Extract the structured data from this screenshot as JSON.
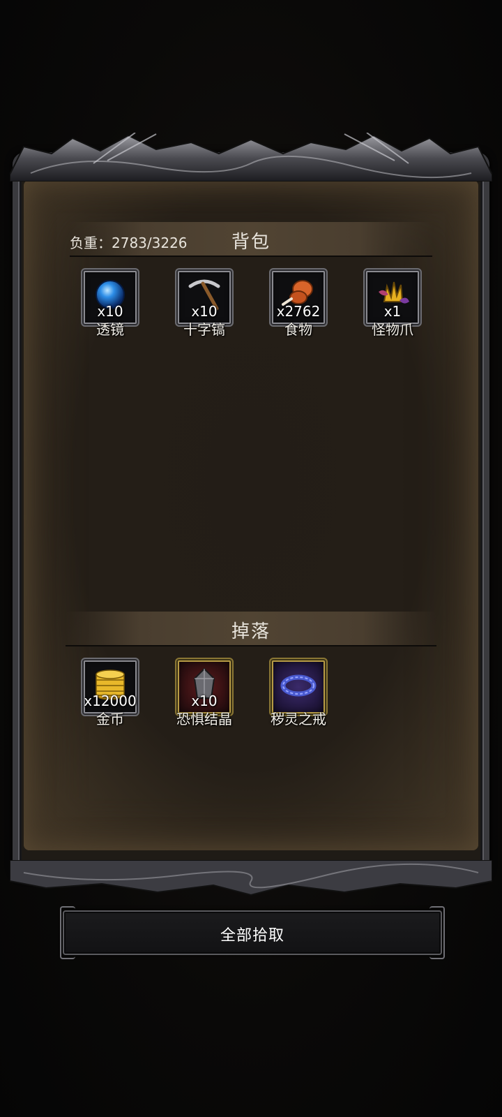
{
  "backpack": {
    "weight_text": "负重：2783/3226",
    "title": "背包",
    "items": [
      {
        "name": "透镜",
        "count": "x10",
        "icon": "blue-orb-icon"
      },
      {
        "name": "十字镐",
        "count": "x10",
        "icon": "pickaxe-icon"
      },
      {
        "name": "食物",
        "count": "x2762",
        "icon": "drumstick-icon"
      },
      {
        "name": "怪物爪",
        "count": "x1",
        "icon": "monster-claw-icon"
      }
    ]
  },
  "drops": {
    "title": "掉落",
    "items": [
      {
        "name": "金币",
        "count": "x12000",
        "icon": "gold-coins-icon"
      },
      {
        "name": "恐惧结晶",
        "count": "x10",
        "icon": "fear-crystal-icon"
      },
      {
        "name": "秽灵之戒",
        "count": "",
        "icon": "ring-icon"
      }
    ]
  },
  "actions": {
    "pickup_all": "全部拾取"
  },
  "colors": {
    "panel": "#241e17",
    "text": "#e8e4dc",
    "gold_border": "#b79b45"
  }
}
